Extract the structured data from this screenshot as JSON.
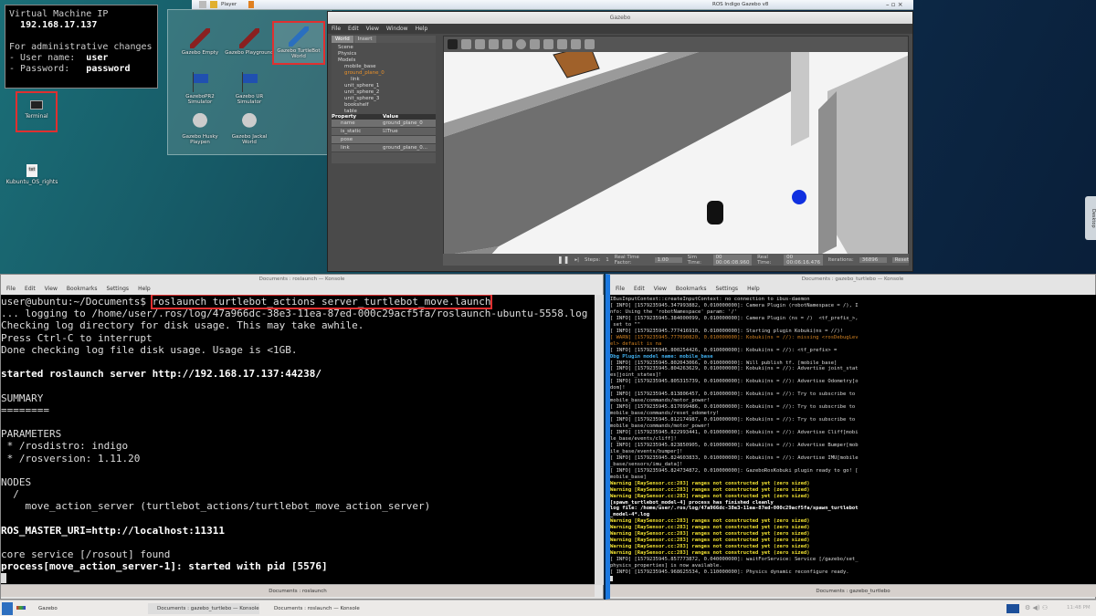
{
  "vm_info": {
    "title": "Virtual Machine IP",
    "ip": "192.168.17.137",
    "admin_heading": "For administrative changes",
    "user_label": "- User name:",
    "user_value": "user",
    "password_label": "- Password:",
    "password_value": "password"
  },
  "desktop_icons": {
    "terminal": "Terminal",
    "file": "Kubuntu_OS_rights",
    "file_glyph": "txt"
  },
  "launcher": [
    {
      "label": "Gazebo Empty",
      "icon": "rocket-icon"
    },
    {
      "label": "Gazebo Playground",
      "icon": "rocket-icon"
    },
    {
      "label": "Gazebo TurtleBot World",
      "icon": "rocket-icon",
      "highlighted": true
    },
    {
      "label": "GazeboPR2 Simulator",
      "icon": "flag-icon"
    },
    {
      "label": "Gazebo UR Simulator",
      "icon": "flag-icon"
    },
    {
      "label": "Gazebo Husky Playpen",
      "icon": "lightbulb-icon"
    },
    {
      "label": "Gazebo Jackal World",
      "icon": "lightbulb-icon"
    }
  ],
  "vm_toolbar": {
    "player_menu": "Player",
    "vm_title": "ROS Indigo Gazebo v8"
  },
  "gazebo": {
    "title": "Gazebo",
    "menu": [
      "File",
      "Edit",
      "View",
      "Window",
      "Help"
    ],
    "tabs": [
      "World",
      "Insert"
    ],
    "tree": [
      {
        "label": "Scene",
        "indent": 1
      },
      {
        "label": "Physics",
        "indent": 1
      },
      {
        "label": "Models",
        "indent": 1
      },
      {
        "label": "mobile_base",
        "indent": 2
      },
      {
        "label": "ground_plane_0",
        "indent": 2,
        "selected": true
      },
      {
        "label": "link",
        "indent": 3
      },
      {
        "label": "unit_sphere_1",
        "indent": 2
      },
      {
        "label": "unit_sphere_2",
        "indent": 2
      },
      {
        "label": "unit_sphere_3",
        "indent": 2
      },
      {
        "label": "bookshelf",
        "indent": 2
      },
      {
        "label": "table",
        "indent": 2
      }
    ],
    "prop_header": [
      "Property",
      "Value"
    ],
    "props": [
      {
        "name": "name",
        "value": "ground_plane_0"
      },
      {
        "name": "is_static",
        "value": "True"
      },
      {
        "name": "pose",
        "value": ""
      },
      {
        "name": "link",
        "value": "ground_plane_0..."
      }
    ],
    "bottom": {
      "steps_label": "Steps:",
      "steps": "1",
      "rtf_label": "Real Time Factor:",
      "rtf": "1.00",
      "sim_label": "Sim Time:",
      "sim": "00 00:06:08.960",
      "real_label": "Real Time:",
      "real": "00 00:06:16.476",
      "iter_label": "Iterations:",
      "iter": "36896",
      "reset": "Reset"
    }
  },
  "left_konsole": {
    "title": "Documents : roslaunch — Konsole",
    "menu": [
      "File",
      "Edit",
      "View",
      "Bookmarks",
      "Settings",
      "Help"
    ],
    "prompt": "user@ubuntu:~/Documents$ ",
    "command": "roslaunch turtlebot_actions server_turtlebot_move.launch",
    "lines": [
      {
        "t": "... logging to /home/user/.ros/log/47a966dc-38e3-11ea-87ed-000c29acf5fa/roslaunch-ubuntu-5558.log"
      },
      {
        "t": "Checking log directory for disk usage. This may take awhile."
      },
      {
        "t": "Press Ctrl-C to interrupt"
      },
      {
        "t": "Done checking log file disk usage. Usage is <1GB."
      },
      {
        "t": ""
      },
      {
        "t": "started roslaunch server http://192.168.17.137:44238/",
        "s": "bold"
      },
      {
        "t": ""
      },
      {
        "t": "SUMMARY"
      },
      {
        "t": "========"
      },
      {
        "t": ""
      },
      {
        "t": "PARAMETERS"
      },
      {
        "t": " * /rosdistro: indigo"
      },
      {
        "t": " * /rosversion: 1.11.20"
      },
      {
        "t": ""
      },
      {
        "t": "NODES"
      },
      {
        "t": "  /"
      },
      {
        "t": "    move_action_server (turtlebot_actions/turtlebot_move_action_server)"
      },
      {
        "t": ""
      },
      {
        "t": "ROS_MASTER_URI=http://localhost:11311",
        "s": "bold"
      },
      {
        "t": ""
      },
      {
        "t": "core service [/rosout] found"
      },
      {
        "t": "process[move_action_server-1]: started with pid [5576]",
        "s": "bold"
      }
    ],
    "tab": "Documents : roslaunch"
  },
  "right_konsole": {
    "title": "Documents : gazebo_turtlebo — Konsole",
    "menu": [
      "File",
      "Edit",
      "View",
      "Bookmarks",
      "Settings",
      "Help"
    ],
    "lines": [
      {
        "t": "IBusInputContext::createInputContext: no connection to ibus-daemon"
      },
      {
        "t": "[ INFO] [1579235945.347993882, 0.010000000]: Camera Plugin (robotNamespace = /), I"
      },
      {
        "t": "nfo: Using the 'robotNamespace' param: '/'"
      },
      {
        "t": "[ INFO] [1579235945.384000099, 0.010000000]: Camera Plugin (ns = /)  <tf_prefix_>,"
      },
      {
        "t": " set to \"\""
      },
      {
        "t": "[ INFO] [1579235945.777416910, 0.010000000]: Starting plugin Kobuki(ns = //)!"
      },
      {
        "t": "[ WARN] [1579235945.777090820, 0.010000000]: Kobuki(ns = //): missing <rosDebugLev",
        "s": "warn"
      },
      {
        "t": "el> default is na",
        "s": "warn"
      },
      {
        "t": "[ INFO] [1579235945.800254426, 0.010000000]: Kobuki(ns = //): <tf_prefix> ="
      },
      {
        "t": "Dbg Plugin model name: mobile_base",
        "s": "dbg"
      },
      {
        "t": "[ INFO] [1579235945.802043066, 0.010000000]: Will publish tf. [mobile_base]"
      },
      {
        "t": "[ INFO] [1579235945.804263629, 0.010000000]: Kobuki(ns = //): Advertise joint_stat"
      },
      {
        "t": "es[joint_states]!"
      },
      {
        "t": "[ INFO] [1579235945.805315739, 0.010000000]: Kobuki(ns = //): Advertise Odometry[o"
      },
      {
        "t": "dom]!"
      },
      {
        "t": "[ INFO] [1579235945.813806457, 0.010000000]: Kobuki(ns = //): Try to subscribe to"
      },
      {
        "t": "mobile_base/commands/motor_power!"
      },
      {
        "t": "[ INFO] [1579235945.817099486, 0.010000000]: Kobuki(ns = //): Try to subscribe to"
      },
      {
        "t": "mobile_base/commands/reset_odometry!"
      },
      {
        "t": "[ INFO] [1579235945.812174987, 0.010000000]: Kobuki(ns = //): Try to subscribe to"
      },
      {
        "t": "mobile_base/commands/motor_power!"
      },
      {
        "t": "[ INFO] [1579235945.822993441, 0.010000000]: Kobuki(ns = //): Advertise Cliff[mobi"
      },
      {
        "t": "le_base/events/cliff]!"
      },
      {
        "t": "[ INFO] [1579235945.823850905, 0.010000000]: Kobuki(ns = //): Advertise Bumper[mob"
      },
      {
        "t": "ile_base/events/bumper]!"
      },
      {
        "t": "[ INFO] [1579235945.824603833, 0.010000000]: Kobuki(ns = //): Advertise IMU[mobile"
      },
      {
        "t": "_base/sensors/imu_data]!"
      },
      {
        "t": "[ INFO] [1579235945.824734872, 0.010000000]: GazeboRosKobuki plugin ready to go! ["
      },
      {
        "t": "mobile_base]"
      },
      {
        "t": "Warning [RaySensor.cc:283] ranges not constructed yet (zero sized)",
        "s": "ylw"
      },
      {
        "t": "Warning [RaySensor.cc:283] ranges not constructed yet (zero sized)",
        "s": "ylw"
      },
      {
        "t": "Warning [RaySensor.cc:283] ranges not constructed yet (zero sized)",
        "s": "ylw"
      },
      {
        "t": "[spawn_turtlebot_model-4] process has finished cleanly",
        "s": "bold"
      },
      {
        "t": "log file: /home/user/.ros/log/47a966dc-38e3-11ea-87ed-000c29acf5fa/spawn_turtlebot",
        "s": "bold"
      },
      {
        "t": "_model-4*.log",
        "s": "bold"
      },
      {
        "t": "Warning [RaySensor.cc:283] ranges not constructed yet (zero sized)",
        "s": "ylw"
      },
      {
        "t": "Warning [RaySensor.cc:283] ranges not constructed yet (zero sized)",
        "s": "ylw"
      },
      {
        "t": "Warning [RaySensor.cc:283] ranges not constructed yet (zero sized)",
        "s": "ylw"
      },
      {
        "t": "Warning [RaySensor.cc:283] ranges not constructed yet (zero sized)",
        "s": "ylw"
      },
      {
        "t": "Warning [RaySensor.cc:283] ranges not constructed yet (zero sized)",
        "s": "ylw"
      },
      {
        "t": "Warning [RaySensor.cc:283] ranges not constructed yet (zero sized)",
        "s": "ylw"
      },
      {
        "t": "[ INFO] [1579235945.857773872, 0.040000000]: waitForService: Service [/gazebo/set_"
      },
      {
        "t": "physics_properties] is now available."
      },
      {
        "t": "[ INFO] [1579235945.968625534, 0.110000000]: Physics dynamic reconfigure ready."
      }
    ],
    "tab": "Documents : gazebo_turtlebo"
  },
  "taskbar": {
    "gazebo": "Gazebo",
    "task1": "Documents : gazebo_turtlebo — Konsole",
    "task2": "Documents : roslaunch — Konsole",
    "clock": "11:48 PM"
  },
  "side_tab": "Desktop",
  "colors": {
    "highlight": "#e03030",
    "konsole_focus": "#1a78e0",
    "warning": "#f0e030"
  }
}
